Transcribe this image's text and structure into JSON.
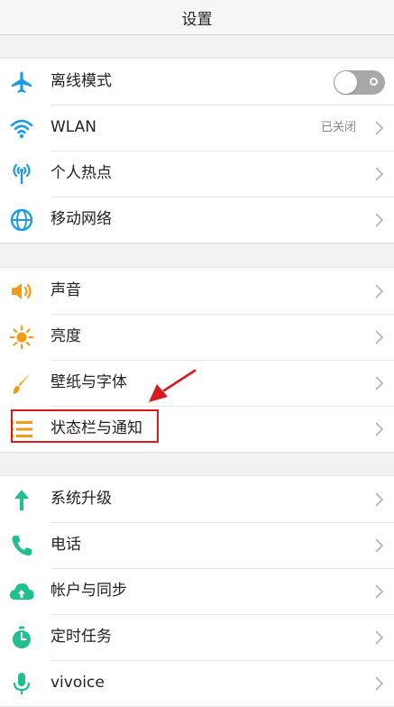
{
  "header": {
    "title": "设置"
  },
  "groups": [
    {
      "items": [
        {
          "label": "离线模式",
          "icon": "airplane-icon",
          "control": "toggle",
          "toggle_on": false
        },
        {
          "label": "WLAN",
          "icon": "wifi-icon",
          "value": "已关闭"
        },
        {
          "label": "个人热点",
          "icon": "hotspot-icon"
        },
        {
          "label": "移动网络",
          "icon": "globe-icon"
        }
      ]
    },
    {
      "items": [
        {
          "label": "声音",
          "icon": "speaker-icon"
        },
        {
          "label": "亮度",
          "icon": "sun-icon"
        },
        {
          "label": "壁纸与字体",
          "icon": "brush-icon"
        },
        {
          "label": "状态栏与通知",
          "icon": "status-bar-icon"
        }
      ]
    },
    {
      "items": [
        {
          "label": "系统升级",
          "icon": "up-arrow-icon"
        },
        {
          "label": "电话",
          "icon": "phone-icon"
        },
        {
          "label": "帐户与同步",
          "icon": "cloud-sync-icon"
        },
        {
          "label": "定时任务",
          "icon": "timer-icon"
        },
        {
          "label": "vivoice",
          "icon": "microphone-icon"
        }
      ]
    }
  ],
  "colors": {
    "blue": "#1e9be8",
    "orange": "#f59a14",
    "green": "#1fbf8f",
    "annotation_red": "#d71920"
  },
  "annotation": {
    "highlighted_item": "状态栏与通知"
  }
}
